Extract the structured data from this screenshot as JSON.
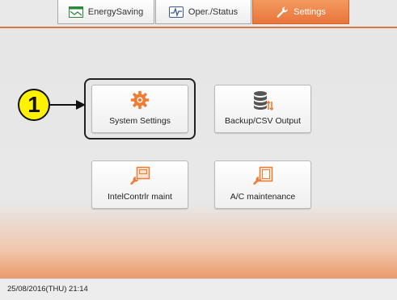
{
  "tabs": {
    "energy_saving": "EnergySaving",
    "oper_status": "Oper./Status",
    "settings": "Settings"
  },
  "buttons": {
    "system_settings": "System Settings",
    "backup_csv": "Backup/CSV Output",
    "intel_maint": "IntelContrlr maint",
    "ac_maint": "A/C maintenance"
  },
  "callout": {
    "number": "1"
  },
  "status": {
    "datetime": "25/08/2016(THU) 21:14"
  },
  "colors": {
    "accent": "#e8753a",
    "callout": "#fff200",
    "icon_orange": "#ef7c33"
  }
}
